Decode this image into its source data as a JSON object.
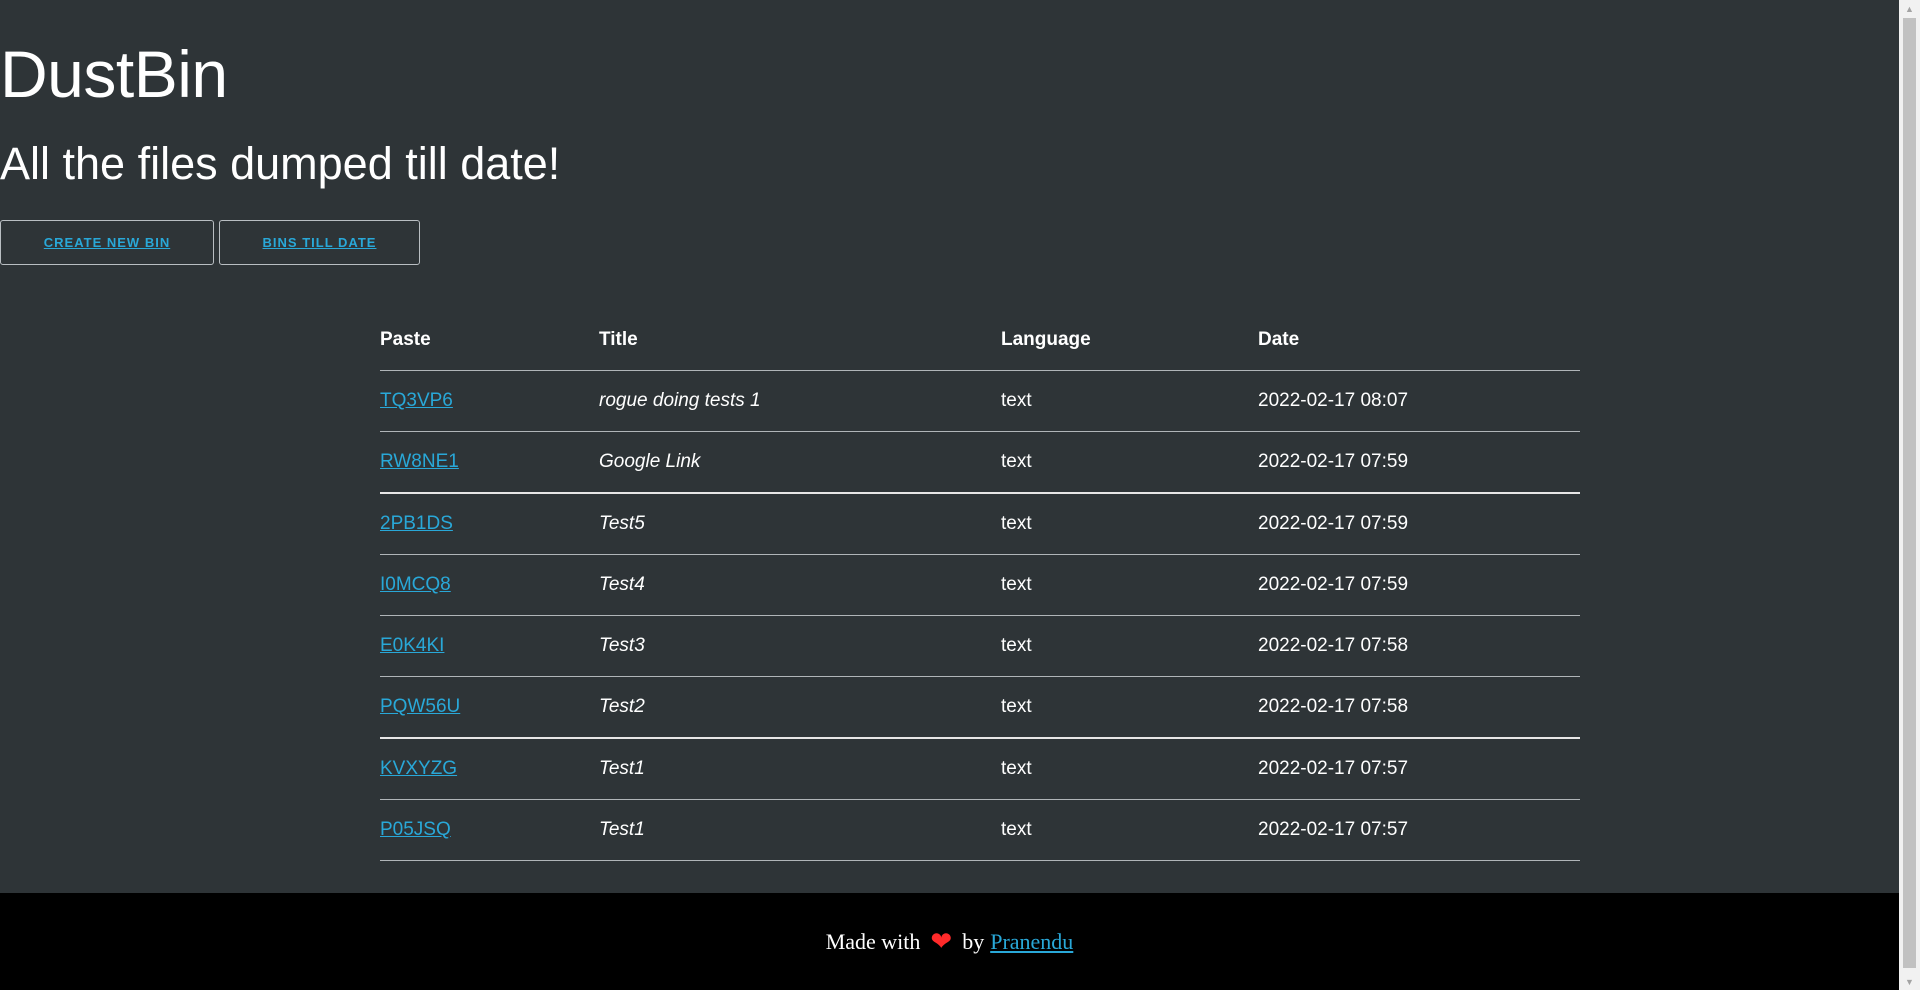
{
  "header": {
    "title": "DustBin",
    "subtitle": "All the files dumped till date!"
  },
  "nav": {
    "create_label": "CREATE NEW BIN",
    "bins_label": "BINS TILL DATE"
  },
  "table": {
    "columns": [
      "Paste",
      "Title",
      "Language",
      "Date"
    ],
    "rows": [
      {
        "paste": "TQ3VP6",
        "title": "rogue doing tests 1",
        "language": "text",
        "date": "2022-02-17 08:07"
      },
      {
        "paste": "RW8NE1",
        "title": "Google Link",
        "language": "text",
        "date": "2022-02-17 07:59"
      },
      {
        "paste": "2PB1DS",
        "title": "Test5",
        "language": "text",
        "date": "2022-02-17 07:59"
      },
      {
        "paste": "I0MCQ8",
        "title": "Test4",
        "language": "text",
        "date": "2022-02-17 07:59"
      },
      {
        "paste": "E0K4KI",
        "title": "Test3",
        "language": "text",
        "date": "2022-02-17 07:58"
      },
      {
        "paste": "PQW56U",
        "title": "Test2",
        "language": "text",
        "date": "2022-02-17 07:58"
      },
      {
        "paste": "KVXYZG",
        "title": "Test1",
        "language": "text",
        "date": "2022-02-17 07:57"
      },
      {
        "paste": "P05JSQ",
        "title": "Test1",
        "language": "text",
        "date": "2022-02-17 07:57"
      }
    ]
  },
  "footer": {
    "made_with": "Made with",
    "heart_icon": "heart-icon",
    "by": "by",
    "author": "Pranendu"
  },
  "colors": {
    "background": "#2e3437",
    "link": "#29a8d8",
    "footer_bg": "#000000",
    "heart": "#ff2a2a"
  }
}
